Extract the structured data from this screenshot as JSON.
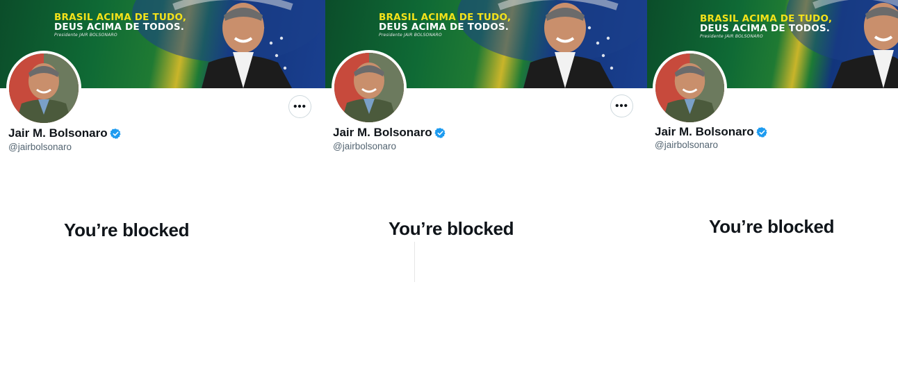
{
  "panels": [
    {
      "banner": {
        "line1": "BRASIL ACIMA DE TUDO,",
        "line2": "DEUS ACIMA DE TODOS.",
        "line3": "Presidente JAIR BOLSONARO"
      },
      "more_button": "•••",
      "name": "Jair M. Bolsonaro",
      "handle": "@jairbolsonaro",
      "blocked_message": "You’re blocked"
    },
    {
      "banner": {
        "line1": "BRASIL ACIMA DE TUDO,",
        "line2": "DEUS ACIMA DE TODOS.",
        "line3": "Presidente JAIR BOLSONARO"
      },
      "more_button": "•••",
      "name": "Jair M. Bolsonaro",
      "handle": "@jairbolsonaro",
      "blocked_message": "You’re blocked"
    },
    {
      "banner": {
        "line1": "BRASIL ACIMA DE TUDO,",
        "line2": "DEUS ACIMA DE TODOS.",
        "line3": "Presidente JAIR BOLSONARO"
      },
      "name": "Jair M. Bolsonaro",
      "handle": "@jairbolsonaro",
      "blocked_message": "You’re blocked"
    }
  ],
  "icons": {
    "verified": "verified-badge-icon",
    "more": "more-options-icon"
  },
  "colors": {
    "verified_blue": "#1d9bf0",
    "banner_yellow": "#f4e21a",
    "text_primary": "#0f1419",
    "text_secondary": "#536471"
  }
}
